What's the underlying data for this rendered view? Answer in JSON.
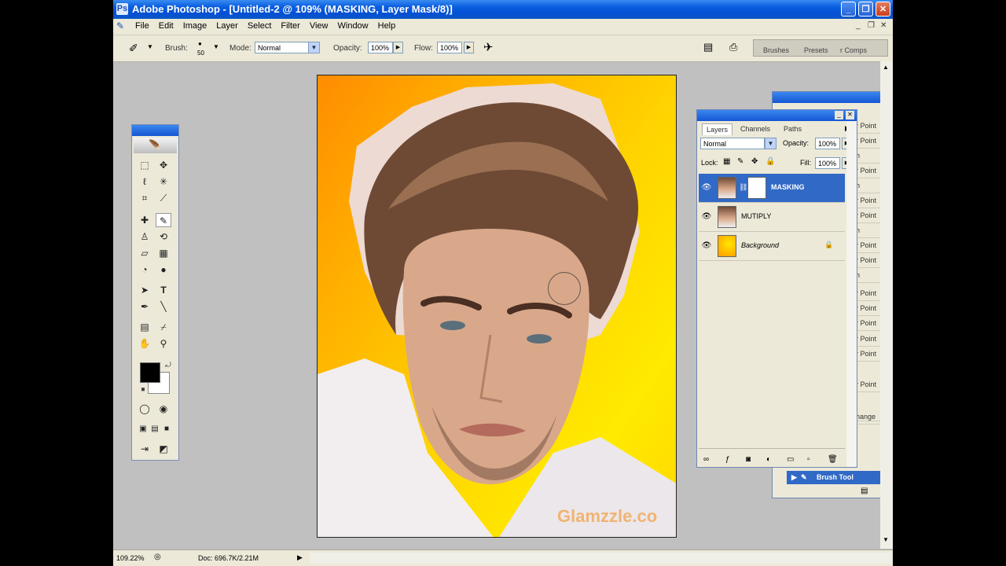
{
  "window": {
    "title": "Adobe Photoshop - [Untitled-2 @ 109% (MASKING, Layer Mask/8)]",
    "buttons": [
      "minimize",
      "restore",
      "close"
    ]
  },
  "menu": {
    "items": [
      "File",
      "Edit",
      "Image",
      "Layer",
      "Select",
      "Filter",
      "View",
      "Window",
      "Help"
    ]
  },
  "options": {
    "brush_label": "Brush:",
    "brush_size": "50",
    "mode_label": "Mode:",
    "mode_value": "Normal",
    "opacity_label": "Opacity:",
    "opacity_value": "100%",
    "flow_label": "Flow:",
    "flow_value": "100%",
    "well_tabs": [
      "Brushes",
      "Presets",
      "r Comps"
    ]
  },
  "canvas": {
    "watermark": "Glamzzle.co",
    "colors": {
      "orange": "#ff8c00",
      "yellow": "#ffe600"
    }
  },
  "toolbox": {
    "foreground": "#000000",
    "background": "#ffffff"
  },
  "layers_panel": {
    "tabs": [
      "Layers",
      "Channels",
      "Paths"
    ],
    "blend_mode": "Normal",
    "opacity_label": "Opacity:",
    "opacity_value": "100%",
    "lock_label": "Lock:",
    "fill_label": "Fill:",
    "fill_value": "100%",
    "layers": [
      {
        "name": "MASKING",
        "selected": true
      },
      {
        "name": "MUTIPLY",
        "selected": false
      },
      {
        "name": "Background",
        "selected": false,
        "locked": true
      }
    ]
  },
  "history_panel": {
    "rows": [
      "r Point",
      "r Point",
      "h",
      "r Point",
      "h",
      "r Point",
      "r Point",
      "h",
      "r Point",
      "r Point",
      "h",
      "r Point",
      "r Point",
      "r Point",
      "r Point",
      "r Point",
      "r Point",
      "",
      "hange",
      ""
    ],
    "current_step": "Brush Tool"
  },
  "status": {
    "zoom": "109.22%",
    "doc": "Doc: 696.7K/2.21M"
  }
}
